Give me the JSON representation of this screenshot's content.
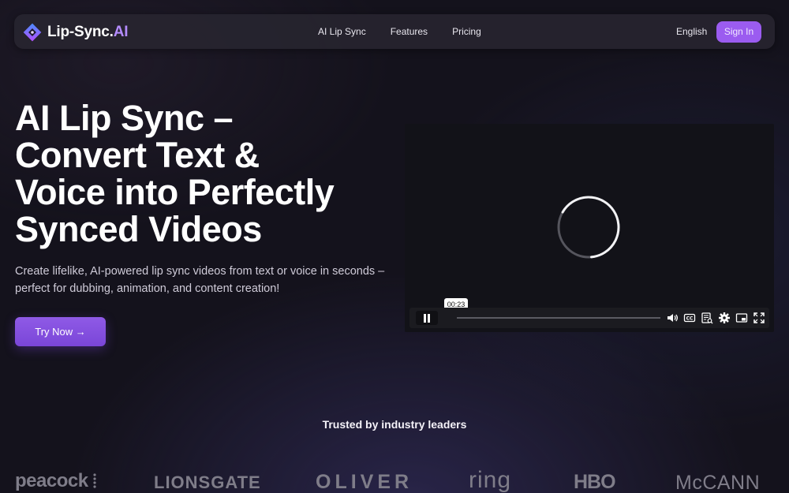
{
  "nav": {
    "logo_text": "Lip-Sync.",
    "logo_suffix": "AI",
    "links": [
      "AI Lip Sync",
      "Features",
      "Pricing"
    ],
    "language": "English",
    "signin_label": "Sign In"
  },
  "hero": {
    "title_lines": [
      "AI Lip Sync –",
      "Convert Text &",
      "Voice into Perfectly",
      "Synced Videos"
    ],
    "subtitle_lines": [
      "Create lifelike, AI-powered lip sync videos from text or voice in seconds –",
      "perfect for dubbing, animation, and content creation!"
    ],
    "cta_label": "Try Now →"
  },
  "video": {
    "time_tooltip": "00:23",
    "controls": [
      "pause-icon",
      "volume-icon",
      "captions-icon",
      "transcript-icon",
      "settings-icon",
      "pip-icon",
      "fullscreen-icon"
    ]
  },
  "trust": {
    "heading": "Trusted by industry leaders",
    "brands": [
      "peacock",
      "LIONSGATE",
      "OLIVER",
      "ring",
      "HBO",
      "McCANN"
    ]
  },
  "colors": {
    "accent": "#9b5cf0",
    "background": "#14121c",
    "brand_gray": "#7f7d89"
  }
}
